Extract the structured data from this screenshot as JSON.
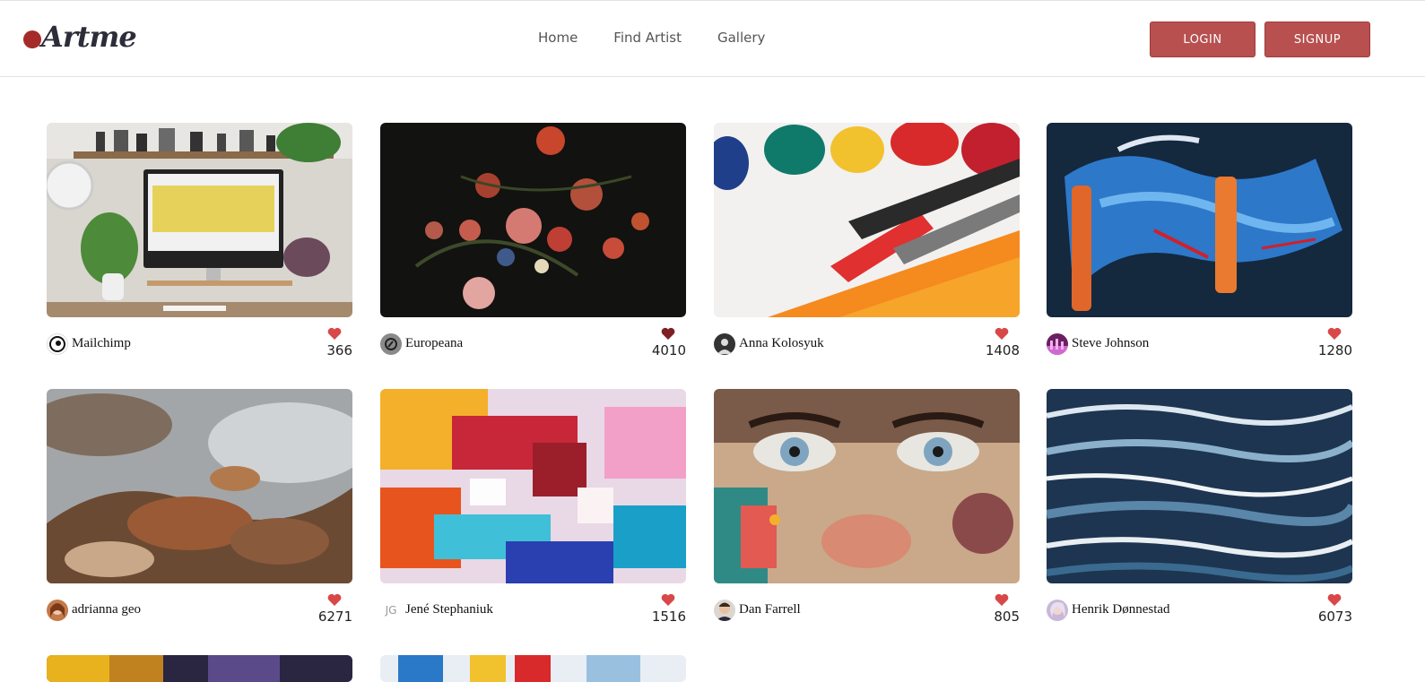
{
  "brand": {
    "name": "Artme",
    "accent": "#b85050"
  },
  "nav": {
    "links": [
      "Home",
      "Find Artist",
      "Gallery"
    ]
  },
  "auth": {
    "login_label": "LOGIN",
    "signup_label": "SIGNUP"
  },
  "cards": [
    {
      "author": "Mailchimp",
      "likes": "366",
      "image": "workspace desk with monitor"
    },
    {
      "author": "Europeana",
      "likes": "4010",
      "image": "dark still life flower painting"
    },
    {
      "author": "Anna Kolosyuk",
      "likes": "1408",
      "image": "paint brushes and paint tubes"
    },
    {
      "author": "Steve Johnson",
      "likes": "1280",
      "image": "blue abstract painting"
    },
    {
      "author": "adrianna geo",
      "likes": "6271",
      "image": "baroque ceiling painting"
    },
    {
      "author": "Jené Stephaniuk",
      "likes": "1516",
      "image": "colorful abstract paint"
    },
    {
      "author": "Dan Farrell",
      "likes": "805",
      "image": "street art face mural"
    },
    {
      "author": "Henrik Dønnestad",
      "likes": "6073",
      "image": "blue ocean wave painting"
    },
    {
      "author": "",
      "likes": "",
      "image": "partially visible artwork"
    },
    {
      "author": "",
      "likes": "",
      "image": "partially visible artwork"
    }
  ],
  "avatar_initials": {
    "jg": "JG"
  }
}
